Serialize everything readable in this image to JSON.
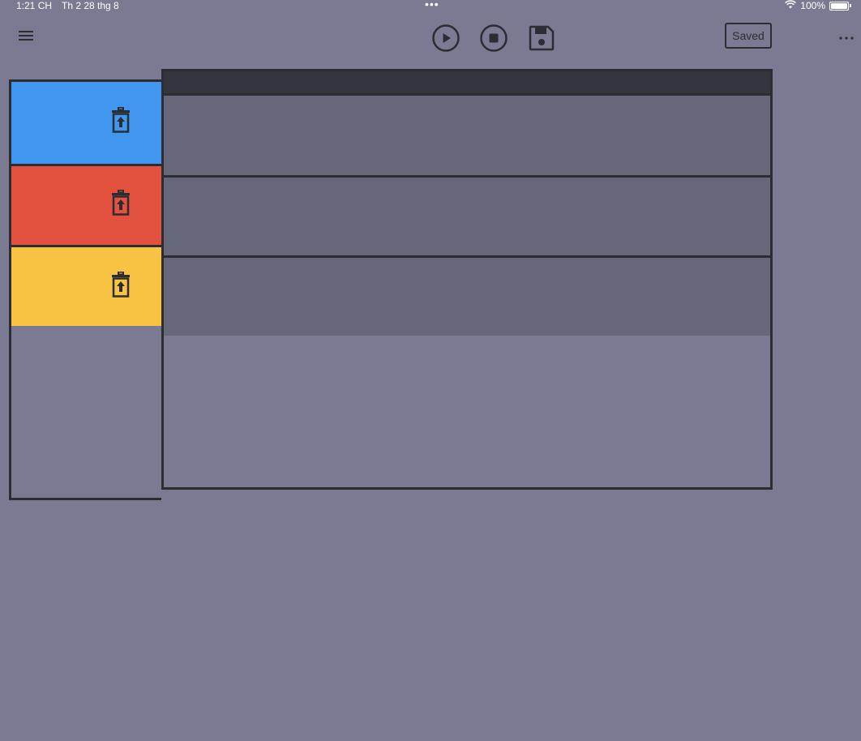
{
  "status_bar": {
    "time": "1:21 CH",
    "date": "Th 2 28 thg 8",
    "dots": "•••",
    "battery": "100%"
  },
  "toolbar": {
    "menu_icon": "hamburger-menu-icon",
    "play_icon": "play-circle-icon",
    "stop_icon": "stop-circle-icon",
    "save_icon": "floppy-disk-icon",
    "saved_label": "Saved",
    "more_icon": "ellipsis-icon"
  },
  "sidebar": {
    "items": [
      {
        "color": "#4196f0",
        "icon": "trash-restore-icon"
      },
      {
        "color": "#e2523f",
        "icon": "trash-restore-icon"
      },
      {
        "color": "#f8c242",
        "icon": "trash-restore-icon"
      }
    ]
  },
  "colors": {
    "background": "#7a7a92",
    "row": "#666779",
    "header": "#34363d",
    "border": "#2b2d33"
  }
}
